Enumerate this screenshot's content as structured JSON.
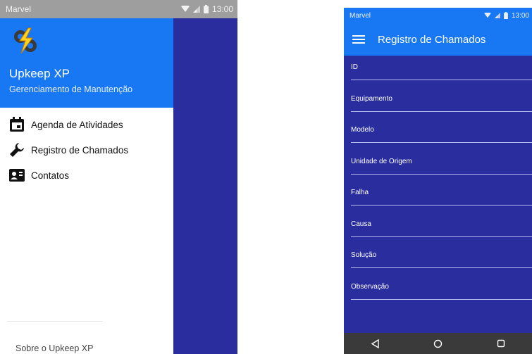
{
  "left_phone": {
    "status_bar": {
      "carrier": "Marvel",
      "time": "13:00",
      "icons": [
        "wifi-icon",
        "signal-icon",
        "battery-icon"
      ]
    },
    "drawer": {
      "app_name": "Upkeep XP",
      "app_subtitle": "Gerenciamento de Manutenção",
      "logo": "lightning-gears-logo",
      "items": [
        {
          "label": "Agenda de Atividades",
          "icon": "calendar-icon"
        },
        {
          "label": "Registro de Chamados",
          "icon": "wrench-icon"
        },
        {
          "label": "Contatos",
          "icon": "contacts-icon"
        }
      ],
      "footer_link": "Sobre o Upkeep XP"
    }
  },
  "right_phone": {
    "status_bar": {
      "carrier": "Marvel",
      "time": "13:00",
      "icons": [
        "wifi-icon",
        "signal-icon",
        "battery-icon"
      ]
    },
    "app_bar": {
      "title": "Registro de Chamados",
      "menu_icon": "hamburger-icon"
    },
    "form_fields": [
      {
        "label": "ID"
      },
      {
        "label": "Equipamento"
      },
      {
        "label": "Modelo"
      },
      {
        "label": "Unidade de Origem"
      },
      {
        "label": "Falha"
      },
      {
        "label": "Causa"
      },
      {
        "label": "Solução"
      },
      {
        "label": "Observação"
      }
    ],
    "nav_bar": [
      "back-icon",
      "home-icon",
      "recents-icon"
    ]
  },
  "colors": {
    "primary_blue": "#1877f2",
    "indigo_background": "#2a2d9e",
    "status_gray": "#9e9e9e",
    "nav_bar": "#3a3a3a"
  }
}
